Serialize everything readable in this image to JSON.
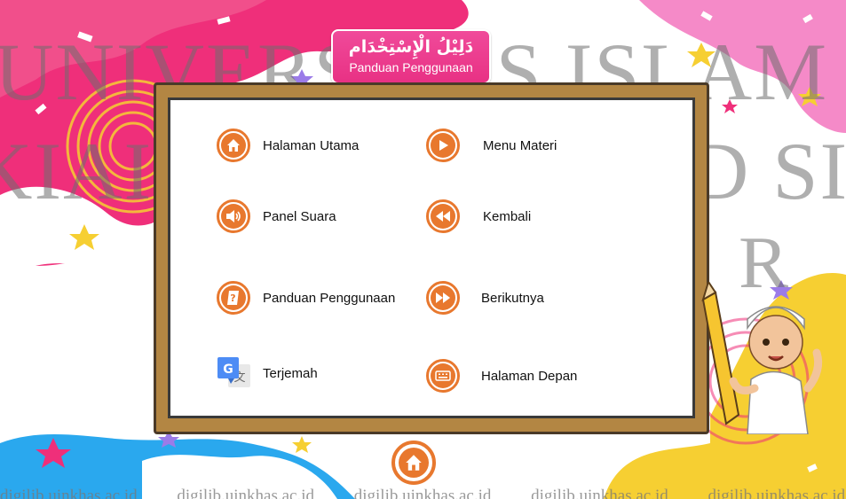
{
  "header": {
    "title_arabic": "دَلِيْلُ الْإِسْتِخْدَام",
    "title_latin": "Panduan Penggunaan"
  },
  "menu": {
    "items": [
      {
        "label": "Halaman Utama",
        "icon": "home-icon"
      },
      {
        "label": "Menu Materi",
        "icon": "play-icon"
      },
      {
        "label": "Panel Suara",
        "icon": "speaker-icon"
      },
      {
        "label": "Kembali",
        "icon": "rewind-icon"
      },
      {
        "label": "Panduan Penggunaan",
        "icon": "help-book-icon"
      },
      {
        "label": "Berikutnya",
        "icon": "fast-forward-icon"
      },
      {
        "label": "Terjemah",
        "icon": "translate-icon"
      },
      {
        "label": "Halaman Depan",
        "icon": "keyboard-icon"
      }
    ]
  },
  "footer_home": {
    "icon": "home-icon"
  },
  "watermark": {
    "line1": "UNIVERSITAS ISLAM NEGERI",
    "line2": "KIAI HAJI ACHMAD SIDDIQ",
    "line3": "JEMBER",
    "footer": [
      "digilib.uinkhas.ac.id",
      "digilib.uinkhas.ac.id",
      "digilib.uinkhas.ac.id",
      "digilib.uinkhas.ac.id",
      "digilib.uinkhas.ac.id"
    ]
  },
  "colors": {
    "accent_orange": "#e8782e",
    "title_pink": "#e83184",
    "board_wood": "#b38643",
    "bg_pink": "#ef2f7a",
    "bg_yellow": "#f6cf32",
    "bg_blue": "#2aa8ee"
  }
}
